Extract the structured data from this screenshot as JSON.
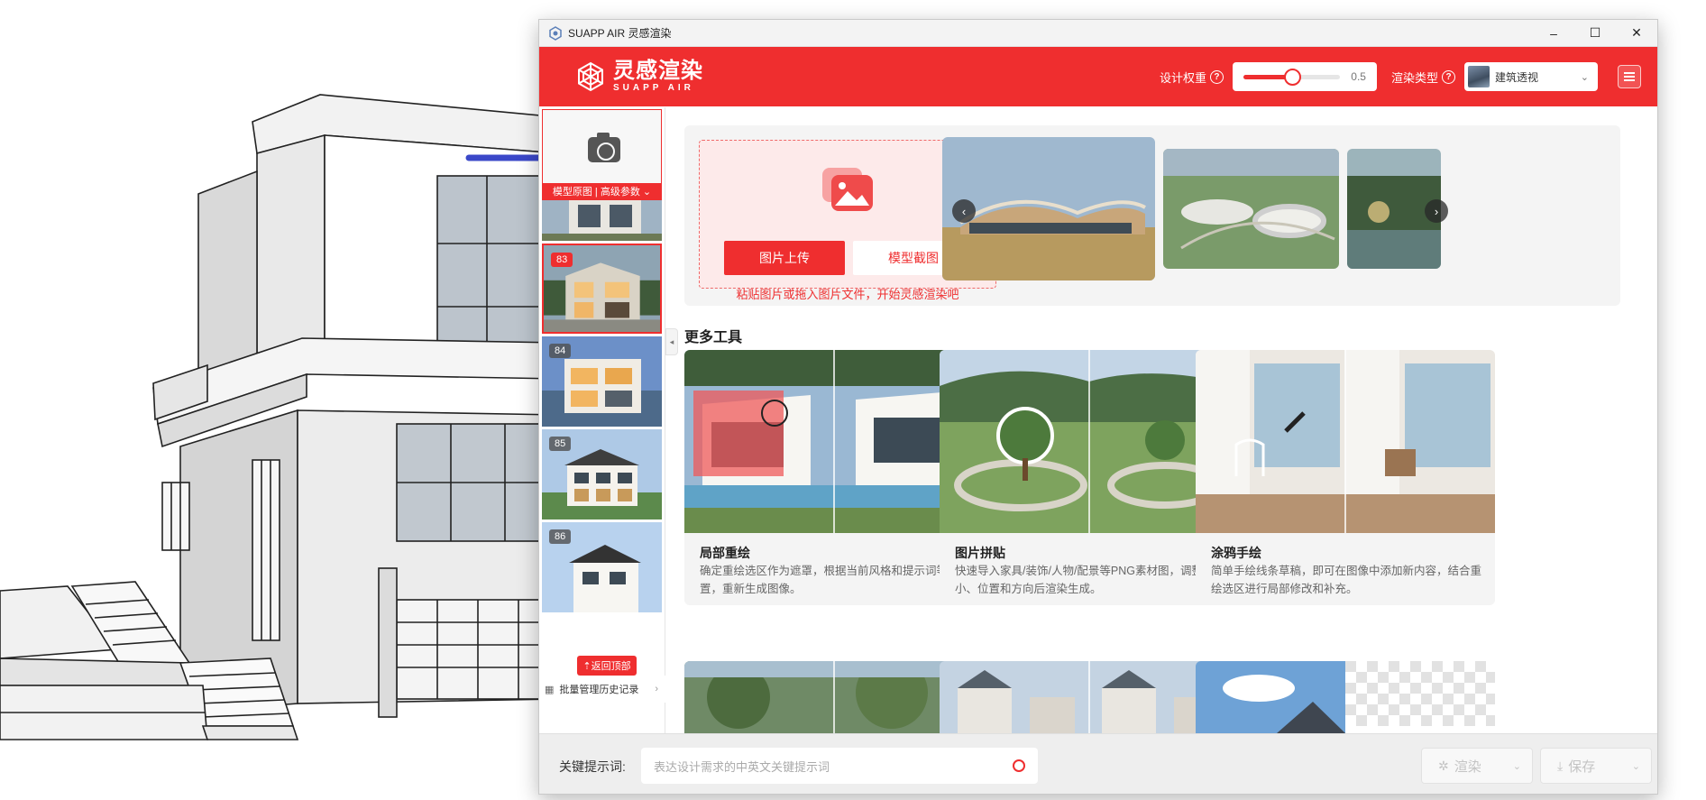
{
  "window": {
    "title": "SUAPP AIR 灵感渲染",
    "minimize": "–",
    "maximize": "☐",
    "close": "✕"
  },
  "header": {
    "logo_name": "灵感渲染",
    "logo_sub": "SUAPP AIR",
    "weight_label": "设计权重",
    "weight_value": "0.5",
    "weight_fraction": 0.5,
    "render_type_label": "渲染类型",
    "render_type_value": "建筑透视",
    "help_icon": "?"
  },
  "sidebar": {
    "camera_bar_label": "模型原图 | 高级参数 ⌄",
    "history": [
      {
        "badge": ""
      },
      {
        "badge": "83",
        "selected": true
      },
      {
        "badge": "84"
      },
      {
        "badge": "85"
      },
      {
        "badge": "86"
      }
    ],
    "back_to_top": "⇡返回顶部",
    "batch_label": "批量管理历史记录",
    "batch_icon": "grid-icon",
    "chevron": "›",
    "collapse": "◂"
  },
  "upload": {
    "upload_button": "图片上传",
    "capture_button": "模型截图",
    "hint": "粘贴图片或拖入图片文件，开始灵感渲染吧"
  },
  "carousel": {
    "prev": "‹",
    "next": "›"
  },
  "more_tools": {
    "title": "更多工具",
    "items": [
      {
        "title": "局部重绘",
        "desc": "确定重绘选区作为遮罩，根据当前风格和提示词等设置，重新生成图像。"
      },
      {
        "title": "图片拼贴",
        "desc": "快速导入家具/装饰/人物/配景等PNG素材图，调整大小、位置和方向后渲染生成。"
      },
      {
        "title": "涂鸦手绘",
        "desc": "简单手绘线条草稿，即可在图像中添加新内容，结合重绘选区进行局部修改和补充。"
      }
    ]
  },
  "bottom": {
    "prompt_label": "关键提示词:",
    "prompt_placeholder": "表达设计需求的中英文关键提示词",
    "render_button": "渲染",
    "save_button": "保存",
    "render_icon": "✲",
    "save_icon": "⤓",
    "dropdown": "⌄"
  },
  "colors": {
    "brand": "#ef2e2f",
    "arrow": "#3b48c9"
  }
}
